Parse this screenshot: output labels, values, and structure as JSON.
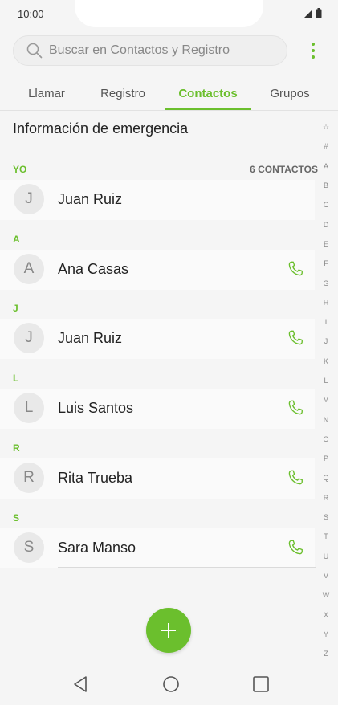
{
  "status_bar": {
    "time": "10:00"
  },
  "search": {
    "placeholder": "Buscar en Contactos y Registro"
  },
  "tabs": [
    {
      "label": "Llamar"
    },
    {
      "label": "Registro"
    },
    {
      "label": "Contactos",
      "active": true
    },
    {
      "label": "Grupos"
    }
  ],
  "emergency_label": "Información de emergencia",
  "me_section": {
    "header": "YO",
    "count_label": "6 CONTACTOS"
  },
  "me_contact": {
    "initial": "J",
    "name": "Juan Ruiz"
  },
  "sections": [
    {
      "header": "A",
      "initial": "A",
      "name": "Ana Casas"
    },
    {
      "header": "J",
      "initial": "J",
      "name": "Juan Ruiz"
    },
    {
      "header": "L",
      "initial": "L",
      "name": "Luis Santos"
    },
    {
      "header": "R",
      "initial": "R",
      "name": "Rita Trueba"
    },
    {
      "header": "S",
      "initial": "S",
      "name": "Sara Manso"
    }
  ],
  "index": [
    "☆",
    "#",
    "A",
    "B",
    "C",
    "D",
    "E",
    "F",
    "G",
    "H",
    "I",
    "J",
    "K",
    "L",
    "M",
    "N",
    "O",
    "P",
    "Q",
    "R",
    "S",
    "T",
    "U",
    "V",
    "W",
    "X",
    "Y",
    "Z"
  ],
  "colors": {
    "accent": "#6bbf2d",
    "background": "#f5f5f5"
  },
  "icons": {
    "search": "search-icon",
    "menu": "more-vert-icon",
    "call": "phone-icon",
    "fab": "plus-icon",
    "nav": [
      "back-icon",
      "home-icon",
      "recents-icon"
    ]
  }
}
